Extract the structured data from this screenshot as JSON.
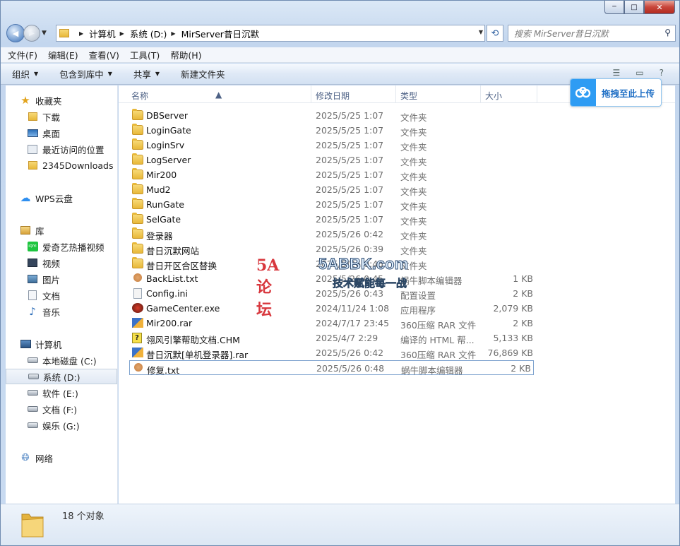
{
  "window": {
    "controls": {
      "minimize": "─",
      "maximize": "□",
      "close": "✕"
    }
  },
  "nav": {
    "back_glyph": "◀",
    "forward_glyph": "▶",
    "breadcrumb": [
      "计算机",
      "系统 (D:)",
      "MirServer昔日沉默"
    ],
    "search_placeholder": "搜索 MirServer昔日沉默",
    "refresh_glyph": "⟲"
  },
  "menu": [
    "文件(F)",
    "编辑(E)",
    "查看(V)",
    "工具(T)",
    "帮助(H)"
  ],
  "toolbar": {
    "organize": "组织",
    "include_library": "包含到库中",
    "share": "共享",
    "new_folder": "新建文件夹"
  },
  "upload_widget": {
    "label": "拖拽至此上传"
  },
  "sidebar": {
    "favorites_title": "收藏夹",
    "favorites": [
      "下载",
      "桌面",
      "最近访问的位置",
      "2345Downloads"
    ],
    "wps": "WPS云盘",
    "library_title": "库",
    "libraries": [
      "爱奇艺热播视频",
      "视频",
      "图片",
      "文档",
      "音乐"
    ],
    "computer_title": "计算机",
    "drives": [
      "本地磁盘 (C:)",
      "系统 (D:)",
      "软件 (E:)",
      "文档 (F:)",
      "娱乐 (G:)"
    ],
    "network": "网络"
  },
  "columns": {
    "name": "名称",
    "date": "修改日期",
    "type": "类型",
    "size": "大小"
  },
  "files": [
    {
      "name": "DBServer",
      "date": "2025/5/25 1:07",
      "type": "文件夹",
      "size": "",
      "icon": "folder-icon"
    },
    {
      "name": "LoginGate",
      "date": "2025/5/25 1:07",
      "type": "文件夹",
      "size": "",
      "icon": "folder-icon"
    },
    {
      "name": "LoginSrv",
      "date": "2025/5/25 1:07",
      "type": "文件夹",
      "size": "",
      "icon": "folder-icon"
    },
    {
      "name": "LogServer",
      "date": "2025/5/25 1:07",
      "type": "文件夹",
      "size": "",
      "icon": "folder-icon"
    },
    {
      "name": "Mir200",
      "date": "2025/5/25 1:07",
      "type": "文件夹",
      "size": "",
      "icon": "folder-icon"
    },
    {
      "name": "Mud2",
      "date": "2025/5/25 1:07",
      "type": "文件夹",
      "size": "",
      "icon": "folder-icon"
    },
    {
      "name": "RunGate",
      "date": "2025/5/25 1:07",
      "type": "文件夹",
      "size": "",
      "icon": "folder-icon"
    },
    {
      "name": "SelGate",
      "date": "2025/5/25 1:07",
      "type": "文件夹",
      "size": "",
      "icon": "folder-icon"
    },
    {
      "name": "登录器",
      "date": "2025/5/26 0:42",
      "type": "文件夹",
      "size": "",
      "icon": "folder-icon"
    },
    {
      "name": "昔日沉默网站",
      "date": "2025/5/26 0:39",
      "type": "文件夹",
      "size": "",
      "icon": "folder-icon"
    },
    {
      "name": "昔日开区合区替换",
      "date": "2025/5/26 0:45",
      "type": "文件夹",
      "size": "",
      "icon": "folder-icon"
    },
    {
      "name": "BackList.txt",
      "date": "2025/5/26 0:45",
      "type": "蜗牛脚本编辑器",
      "size": "1 KB",
      "icon": "text-file-icon"
    },
    {
      "name": "Config.ini",
      "date": "2025/5/26 0:43",
      "type": "配置设置",
      "size": "2 KB",
      "icon": "config-file-icon"
    },
    {
      "name": "GameCenter.exe",
      "date": "2024/11/24 1:08",
      "type": "应用程序",
      "size": "2,079 KB",
      "icon": "exe-file-icon"
    },
    {
      "name": "Mir200.rar",
      "date": "2024/7/17 23:45",
      "type": "360压缩 RAR 文件",
      "size": "2 KB",
      "icon": "rar-file-icon"
    },
    {
      "name": "翎风引擎帮助文档.CHM",
      "date": "2025/4/7 2:29",
      "type": "编译的 HTML 帮...",
      "size": "5,133 KB",
      "icon": "chm-file-icon"
    },
    {
      "name": "昔日沉默[单机登录器].rar",
      "date": "2025/5/26 0:42",
      "type": "360压缩 RAR 文件",
      "size": "76,869 KB",
      "icon": "rar-file-icon"
    },
    {
      "name": "修复.txt",
      "date": "2025/5/26 0:48",
      "type": "蜗牛脚本编辑器",
      "size": "2 KB",
      "icon": "text-file-icon"
    }
  ],
  "watermark": {
    "logo": "5A论坛",
    "url": "5ABBK.com",
    "slogan": "技术赋能每一战"
  },
  "status": {
    "count": "18 个对象"
  }
}
